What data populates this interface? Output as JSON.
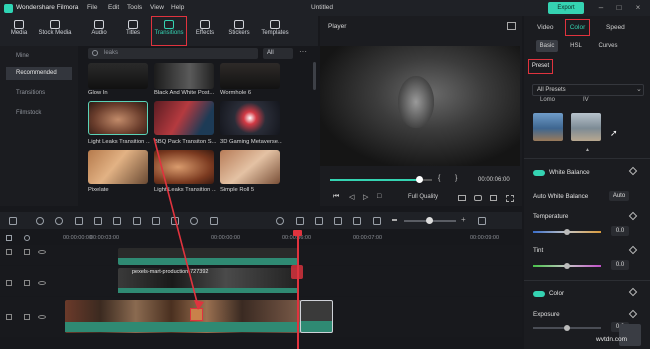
{
  "app": {
    "name": "Wondershare Filmora",
    "doc_title": "Untitled",
    "export": "Export"
  },
  "menus": [
    "File",
    "Edit",
    "Tools",
    "View",
    "Help"
  ],
  "toolbar": {
    "items": [
      "Media",
      "Stock Media",
      "Audio",
      "Titles",
      "Transitions",
      "Effects",
      "Stickers",
      "Templates"
    ]
  },
  "leftnav": {
    "items": [
      "Mine",
      "Recommended",
      "Transitions",
      "Filmstock"
    ]
  },
  "browser": {
    "search_value": "leaks",
    "filter": "All",
    "tiles": [
      {
        "label": "Glow In"
      },
      {
        "label": "Black And White Post..."
      },
      {
        "label": "Wormhole 6"
      },
      {
        "label": "Light Leaks Transition ..."
      },
      {
        "label": "BBQ Pack Transiton S..."
      },
      {
        "label": "3D Gaming Metaverse..."
      },
      {
        "label": "Pixelate"
      },
      {
        "label": "Light Leaks Transition ..."
      },
      {
        "label": "Simple Roll 5"
      }
    ]
  },
  "player": {
    "title": "Player",
    "timecode": "00:00:06:00",
    "quality": "Full Quality",
    "progress": 0.88
  },
  "right": {
    "tabs": [
      "Video",
      "Color",
      "Speed"
    ],
    "subtabs": [
      "Basic",
      "HSL",
      "Curves"
    ],
    "preset_label": "Preset",
    "preset_dropdown": "All Presets",
    "preset_names": [
      "Lomo",
      "IV"
    ],
    "white_balance": "White Balance",
    "auto_white_balance": "Auto White Balance",
    "auto_label": "Auto",
    "temperature": {
      "label": "Temperature",
      "value": "0.0"
    },
    "tint": {
      "label": "Tint",
      "value": "0.0"
    },
    "color": "Color",
    "exposure": {
      "label": "Exposure",
      "value": "0.0"
    }
  },
  "timeline": {
    "ticks": [
      "00:00:00:00",
      "00:00:03:00",
      "00:00:06:00",
      "00:00:07:00",
      "00:00:09:00"
    ],
    "clip_label": "pexels-mart-production-727392"
  },
  "watermark": "wvtdn.com"
}
